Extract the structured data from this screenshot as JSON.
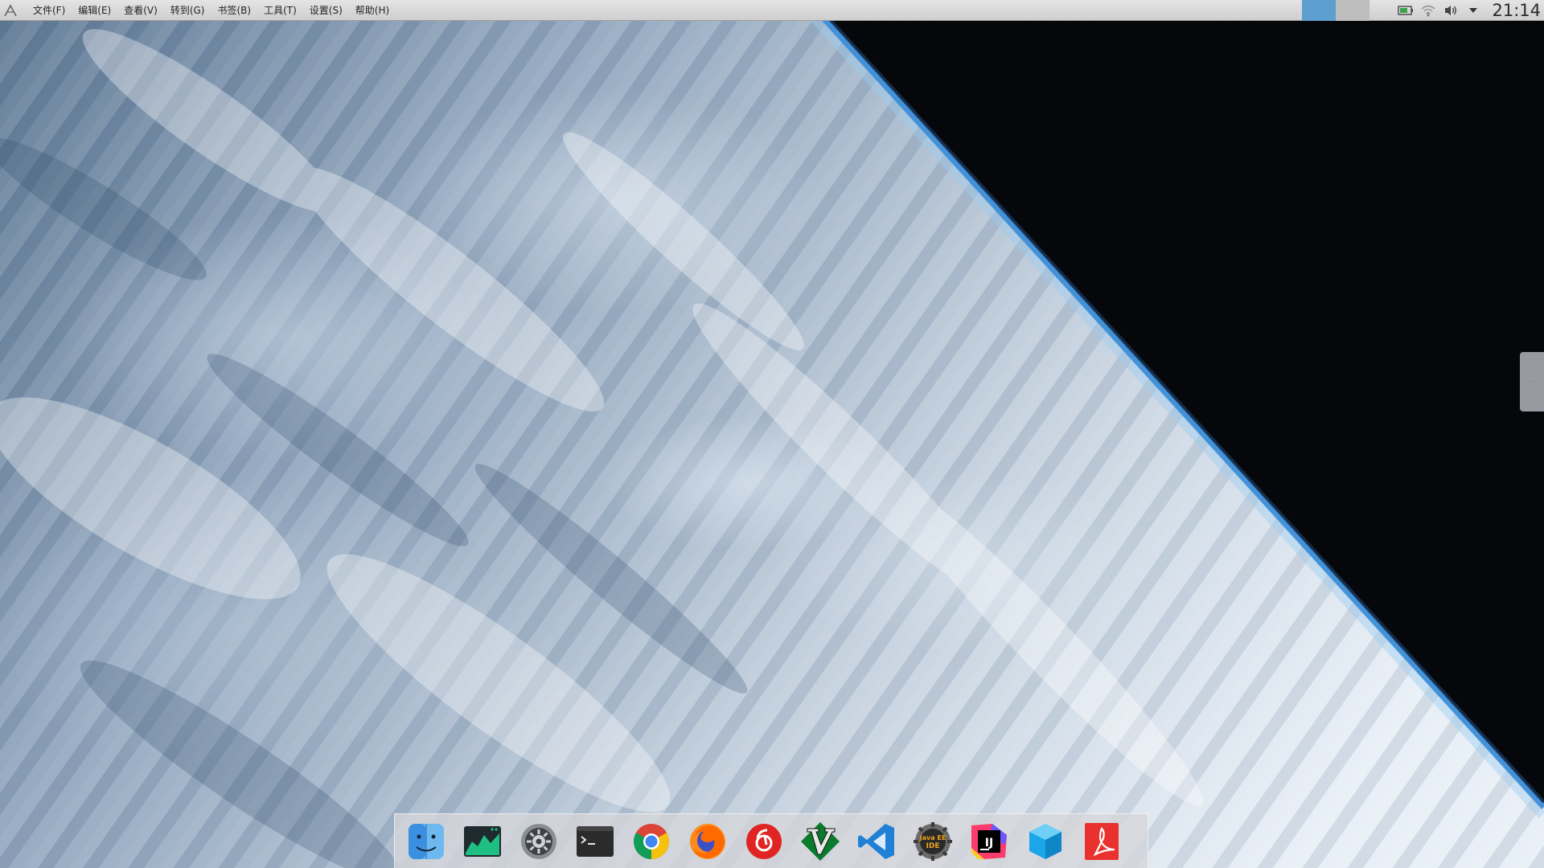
{
  "menubar": {
    "logo_icon": "kde-logo-icon",
    "items": [
      {
        "label": "文件(F)"
      },
      {
        "label": "编辑(E)"
      },
      {
        "label": "查看(V)"
      },
      {
        "label": "转到(G)"
      },
      {
        "label": "书签(B)"
      },
      {
        "label": "工具(T)"
      },
      {
        "label": "设置(S)"
      },
      {
        "label": "帮助(H)"
      }
    ]
  },
  "tray": {
    "workspace_active_color": "#5d9fcf",
    "icons": [
      "battery-icon",
      "wifi-icon",
      "volume-icon",
      "tray-arrow-icon"
    ],
    "clock": "21:14"
  },
  "dock": {
    "items": [
      {
        "name": "finder-icon"
      },
      {
        "name": "system-monitor-icon"
      },
      {
        "name": "system-settings-icon"
      },
      {
        "name": "terminal-icon"
      },
      {
        "name": "chrome-icon"
      },
      {
        "name": "firefox-icon"
      },
      {
        "name": "netease-music-icon"
      },
      {
        "name": "vim-icon"
      },
      {
        "name": "vscode-icon"
      },
      {
        "name": "eclipse-java-ee-icon"
      },
      {
        "name": "intellij-icon"
      },
      {
        "name": "virtualbox-icon"
      },
      {
        "name": "pdf-reader-icon"
      }
    ]
  }
}
